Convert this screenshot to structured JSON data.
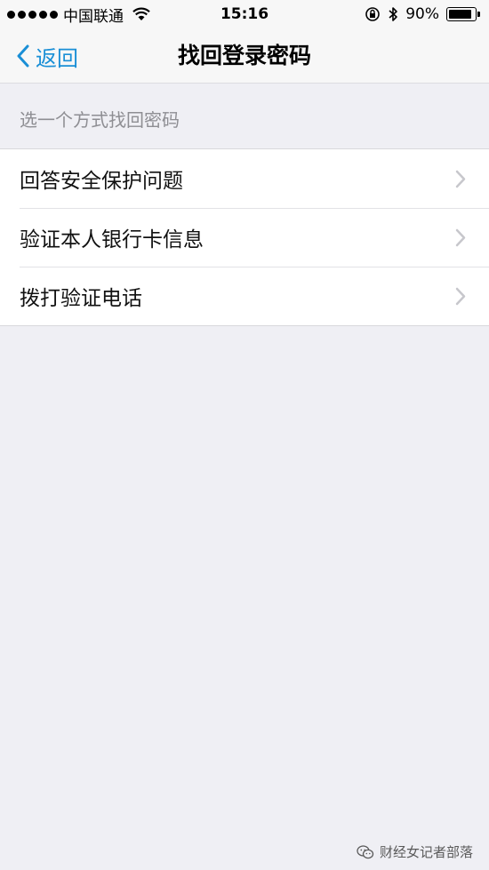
{
  "status_bar": {
    "carrier": "中国联通",
    "time": "15:16",
    "battery_percent": "90%",
    "battery_level": 0.9,
    "icons": [
      "signal-dots",
      "wifi-icon",
      "orientation-lock-icon",
      "bluetooth-icon",
      "battery-icon"
    ]
  },
  "nav": {
    "back_label": "返回",
    "title": "找回登录密码"
  },
  "section": {
    "header": "选一个方式找回密码"
  },
  "options": [
    {
      "label": "回答安全保护问题"
    },
    {
      "label": "验证本人银行卡信息"
    },
    {
      "label": "拨打验证电话"
    }
  ],
  "watermark": {
    "text": "财经女记者部落"
  },
  "colors": {
    "accent": "#1a8fd6",
    "background": "#efeff4",
    "secondary_text": "#8e8e93"
  }
}
